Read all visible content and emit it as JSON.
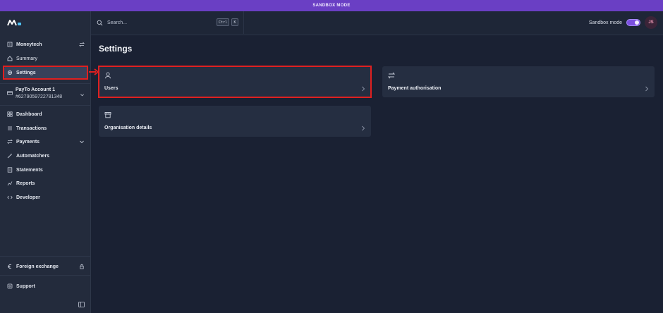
{
  "banner": {
    "text": "SANDBOX MODE"
  },
  "search": {
    "placeholder": "Search...",
    "key1": "Ctrl",
    "key2": "K"
  },
  "header": {
    "sandbox_label": "Sandbox mode",
    "avatar_initials": "JS"
  },
  "sidebar": {
    "org": "Moneytech",
    "summary": "Summary",
    "settings": "Settings",
    "account_name": "PayTo Account 1",
    "account_number": "#6279059722781348",
    "items": [
      "Dashboard",
      "Transactions",
      "Payments",
      "Automatchers",
      "Statements",
      "Reports",
      "Developer"
    ],
    "foreign_exchange": "Foreign exchange",
    "support": "Support"
  },
  "main": {
    "title": "Settings",
    "cards": {
      "users": "Users",
      "payment_authorisation": "Payment authorisation",
      "organisation_details": "Organisation details"
    }
  },
  "colors": {
    "banner": "#6a3fc4",
    "background": "#1a2133",
    "sidebar": "#232b3c",
    "card": "#252e41",
    "highlight": "#e02020",
    "toggle": "#7b4fe0"
  }
}
